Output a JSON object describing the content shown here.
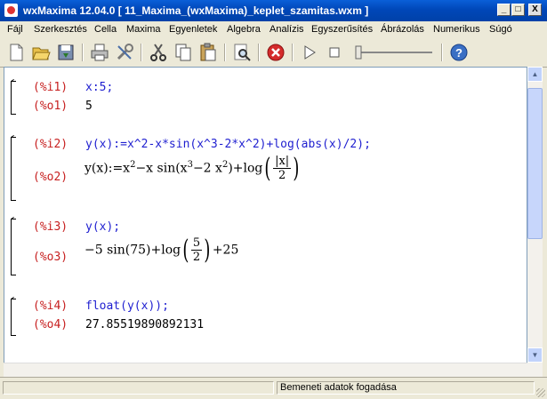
{
  "window": {
    "title": "wxMaxima 12.04.0  [ 11_Maxima_(wxMaxima)_keplet_szamitas.wxm ]",
    "minimize": "_",
    "maximize": "□",
    "close": "X"
  },
  "menubar": {
    "items": [
      "Fájl",
      "Szerkesztés",
      "Cella",
      "Maxima",
      "Egyenletek",
      "Algebra",
      "Analízis",
      "Egyszerűsítés",
      "Ábrázolás",
      "Numerikus",
      "Súgó"
    ]
  },
  "toolbar": {
    "buttons": [
      "new-file-icon",
      "open-folder-icon",
      "save-icon",
      "print-icon",
      "settings-icon",
      "cut-icon",
      "copy-icon",
      "paste-icon",
      "find-icon",
      "stop-icon",
      "play-icon",
      "stop-square-icon",
      "slider-icon",
      "help-icon"
    ]
  },
  "cells": [
    {
      "input_label": "(%i1)",
      "input": "x:5;",
      "output_label": "(%o1)",
      "output": "5"
    },
    {
      "input_label": "(%i2)",
      "input": "y(x):=x^2-x*sin(x^3-2*x^2)+log(abs(x)/2);",
      "output_label": "(%o2)",
      "output_parts": {
        "lhs": "y(x):=x",
        "exp2": "2",
        "mid1": "−x sin(x",
        "exp3": "3",
        "mid2": "−2 x",
        "exp2b": "2",
        "mid3": ")+log",
        "frac_num": "|x|",
        "frac_den": "2"
      }
    },
    {
      "input_label": "(%i3)",
      "input": "y(x);",
      "output_label": "(%o3)",
      "output_parts": {
        "pre": "−5 sin(75)+log",
        "frac_num": "5",
        "frac_den": "2",
        "post": "+25"
      }
    },
    {
      "input_label": "(%i4)",
      "input": "float(y(x));",
      "output_label": "(%o4)",
      "output": "27.85519890892131"
    }
  ],
  "status": {
    "text": "Bemeneti adatok fogadása"
  }
}
